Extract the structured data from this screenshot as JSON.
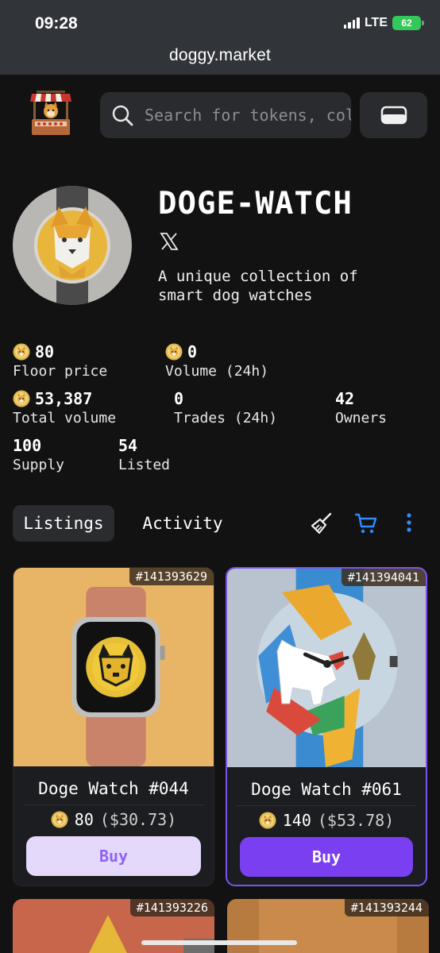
{
  "status_bar": {
    "time": "09:28",
    "network": "LTE",
    "battery": "62"
  },
  "browser": {
    "url": "doggy.market"
  },
  "header": {
    "search_placeholder": "Search for tokens, collections"
  },
  "collection": {
    "title": "DOGE-WATCH",
    "description": "A unique collection of smart dog watches"
  },
  "stats": {
    "floor_price": {
      "value": "80",
      "label": "Floor price"
    },
    "volume_24h": {
      "value": "0",
      "label": "Volume (24h)"
    },
    "total_volume": {
      "value": "53,387",
      "label": "Total volume"
    },
    "trades_24h": {
      "value": "0",
      "label": "Trades (24h)"
    },
    "owners": {
      "value": "42",
      "label": "Owners"
    },
    "supply": {
      "value": "100",
      "label": "Supply"
    },
    "listed": {
      "value": "54",
      "label": "Listed"
    }
  },
  "tabs": {
    "listings": "Listings",
    "activity": "Activity"
  },
  "listings": [
    {
      "id": "#141393629",
      "name": "Doge Watch #044",
      "price": "80",
      "usd": "($30.73)",
      "buy": "Buy"
    },
    {
      "id": "#141394041",
      "name": "Doge Watch #061",
      "price": "140",
      "usd": "($53.78)",
      "buy": "Buy"
    },
    {
      "id": "#141393226"
    },
    {
      "id": "#141393244"
    }
  ],
  "colors": {
    "accent": "#7b3ff2",
    "accent_light": "#e4d9fb",
    "coin": "#e0b94f"
  }
}
